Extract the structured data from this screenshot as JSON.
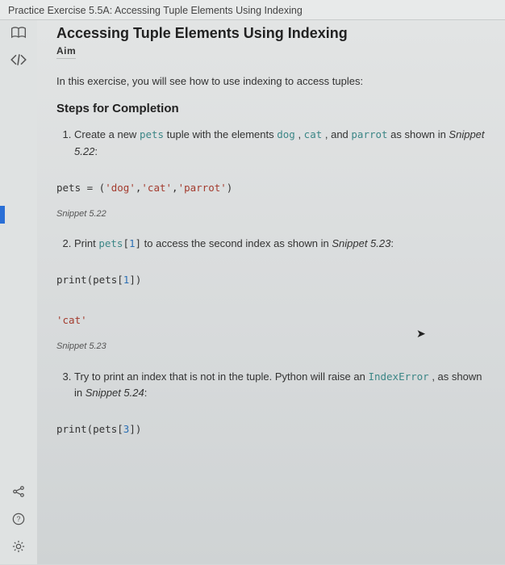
{
  "tab": {
    "title": "Practice Exercise 5.5A: Accessing Tuple Elements Using Indexing"
  },
  "page": {
    "title": "Accessing Tuple Elements Using Indexing",
    "aim_label": "Aim",
    "intro": "In this exercise, you will see how to use indexing to access tuples:",
    "steps_heading": "Steps for Completion"
  },
  "steps": {
    "s1": {
      "pre": "Create a new ",
      "var": "pets",
      "mid1": " tuple with the elements ",
      "el1": "dog",
      "sep1": " , ",
      "el2": "cat",
      "sep2": " , and ",
      "el3": "parrot",
      "post": " as shown in ",
      "snref": "Snippet 5.22",
      "colon": ":"
    },
    "s2": {
      "pre": "Print ",
      "var": "pets",
      "bracket_open": "[",
      "idx": "1",
      "bracket_close": "]",
      "mid": " to access the second index as shown in ",
      "snref": "Snippet 5.23",
      "colon": ":"
    },
    "s3": {
      "pre": "Try to print an index that is not in the tuple. Python will raise an ",
      "err": "IndexError",
      "mid": " , as shown in ",
      "snref": "Snippet 5.24",
      "colon": ":"
    }
  },
  "code": {
    "c1": {
      "lhs": "pets = (",
      "s1": "'dog'",
      "c1": ",",
      "s2": "'cat'",
      "c2": ",",
      "s3": "'parrot'",
      "rhs": ")"
    },
    "c2": {
      "fn": "print(pets[",
      "idx": "1",
      "end": "])"
    },
    "c3": {
      "val": "'cat'"
    },
    "c4": {
      "fn": "print(pets[",
      "idx": "3",
      "end": "])"
    }
  },
  "labels": {
    "sn1": "Snippet 5.22",
    "sn2": "Snippet 5.23"
  }
}
